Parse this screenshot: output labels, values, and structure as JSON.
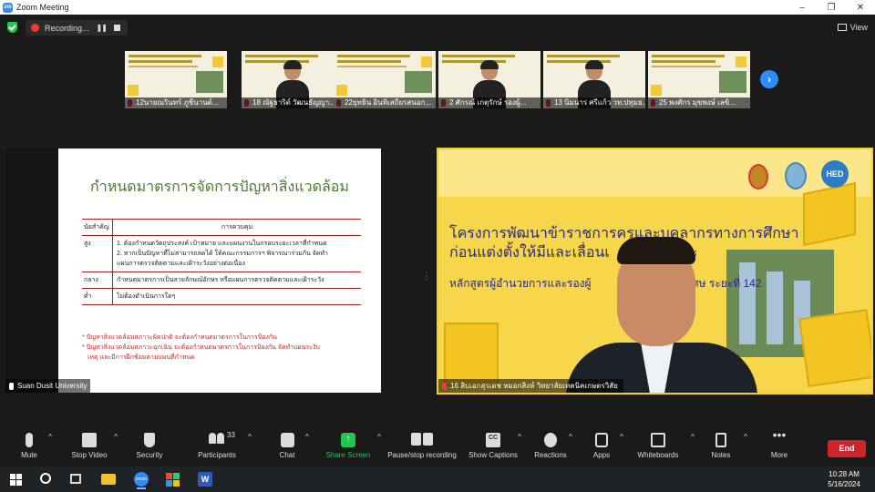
{
  "window": {
    "title": "Zoom Meeting",
    "logo_text": "zm",
    "controls": [
      "–",
      "❐",
      "✕"
    ]
  },
  "recording": {
    "status_text": "Recording...",
    "pause_glyph": "❚❚",
    "view_label": "View"
  },
  "thumbnails": [
    {
      "label": "12นายณรินทร์ ภูชีนานต์...",
      "has_person": false
    },
    {
      "label": "18 ณัฐธาริต์ วัฒนธัญญา...",
      "has_person": true
    },
    {
      "label": "22ยุทธิน อินทิเสถียรสนอก...",
      "has_person": false
    },
    {
      "label": "2 ศักรณ์ เกตุรักษ์ รองผู้...",
      "has_person": true
    },
    {
      "label": "13 นิมนาร ศรีแก้ว วท.ปทุมธ...",
      "has_person": true
    },
    {
      "label": "25 พงศักร มุขพงษ์ เลขิ...",
      "has_person": false
    }
  ],
  "next_glyph": "›",
  "shared_slide": {
    "title": "กำหนดมาตรการจัดการปัญหาสิ่งแวดล้อม",
    "table_head": [
      "นัยสำคัญ",
      "การควบคุม"
    ],
    "rows": [
      {
        "level": "สูง",
        "lines": [
          "1. ต้องกำหนดวัตถุประสงค์ เป้าหมาย และแผนงานในกรอบระยะเวลาที่กำหนด",
          "2. หากเป็นปัญหาที่ไม่สามารถลดได้ ให้คณะกรรมการฯ พิจารณาร่วมกัน จัดทำ",
          "แผนการตรวจติดตามและเฝ้าระวังอย่างต่อเนื่อง"
        ]
      },
      {
        "level": "กลาง",
        "lines": [
          "กำหนดมาตรการเป็นลายลักษณ์อักษร หรือแผนการตรวจติดตามและเฝ้าระวัง"
        ]
      },
      {
        "level": "ต่ำ",
        "lines": [
          "ไม่ต้องดำเนินการใดๆ"
        ]
      }
    ],
    "notes": [
      "* ปัญหาสิ่งแวดล้อมสภาวะผิดปกติ จะต้องกำหนดมาตรการในการป้องกัน",
      "* ปัญหาสิ่งแวดล้อมสภาวะฉุกเฉิน จะต้องกำหนดมาตรการในการป้องกัน จัดทำแผนระงับ",
      "เหตุ และมีการฝึกซ้อมตามแผนที่กำหนด"
    ],
    "presenter": "Suan Dusit University"
  },
  "speaker_panel": {
    "title_line1": "โครงการพัฒนาข้าราชการครูและบุคลากรทางการศึกษา",
    "title_line2": "ก่อนแต่งตั้งให้มีและเลื่อนเ",
    "title_line2_end": "ะ",
    "subtitle": "หลักสูตรผู้อำนวยการและรองผู้",
    "subtitle_end": "การพิเศษ ระยะที่ 142",
    "logo3_text": "HED",
    "name": "16 สิบเอกสุรเดช หมอกสิงห์ วิทยาลัยเทคนิคเกษตรวิสัย"
  },
  "toolbar": {
    "items": [
      {
        "label": "Mute"
      },
      {
        "label": "Stop Video"
      },
      {
        "label": "Security"
      },
      {
        "label": "Participants",
        "count": "33"
      },
      {
        "label": "Chat"
      },
      {
        "label": "Share Screen"
      },
      {
        "label": "Pause/stop recording"
      },
      {
        "label": "Show Captions",
        "icon_text": "CC"
      },
      {
        "label": "Reactions"
      },
      {
        "label": "Apps"
      },
      {
        "label": "Whiteboards"
      },
      {
        "label": "Notes"
      },
      {
        "label": "More"
      }
    ],
    "end_label": "End",
    "caret": "^",
    "share_glyph": "↑",
    "more_glyph": "•••"
  },
  "taskbar": {
    "zoom_text": "zoom",
    "word_text": "W",
    "time": "10:28 AM",
    "date": "5/16/2024"
  },
  "colors": {
    "accent": "#2d8cff",
    "end": "#d0242b",
    "share": "#23c552",
    "slide_title": "#4d7a2e",
    "panel_yellow": "#f6d64a"
  }
}
